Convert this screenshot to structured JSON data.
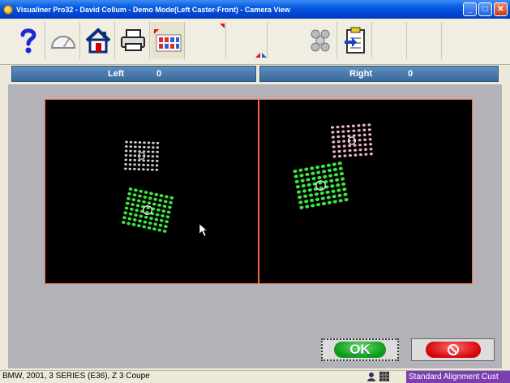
{
  "window": {
    "title": "Visualiner Pro32 - David Collum - Demo Mode(Left Caster-Front)  - Camera View"
  },
  "toolbar": {
    "buttons": [
      {
        "name": "help",
        "icon": "question-icon"
      },
      {
        "name": "gauge",
        "icon": "speedometer-icon"
      },
      {
        "name": "home",
        "icon": "home-icon"
      },
      {
        "name": "print",
        "icon": "printer-icon"
      },
      {
        "name": "camera-view",
        "icon": "target-grid-icon"
      },
      {
        "name": "empty-1",
        "icon": "red-marker-icon"
      },
      {
        "name": "empty-2",
        "icon": "red-marker-icon"
      },
      {
        "name": "sensors",
        "icon": "sensor-cluster-icon"
      },
      {
        "name": "clipboard",
        "icon": "clipboard-arrow-icon"
      }
    ]
  },
  "panels": {
    "left": {
      "label": "Left",
      "value": "0"
    },
    "right": {
      "label": "Right",
      "value": "0"
    }
  },
  "buttons": {
    "ok_label": "OK",
    "cancel_icon": "no-entry-icon"
  },
  "status": {
    "vehicle": "BMW, 2001, 3 SERIES (E36), Z 3 Coupe",
    "mode": "Standard Alignment Cust"
  },
  "colors": {
    "accent": "#ff6a3d",
    "target_green": "#3fe33f",
    "target_pink": "#f0b4c8",
    "mode_purple": "#7b3fb2"
  }
}
